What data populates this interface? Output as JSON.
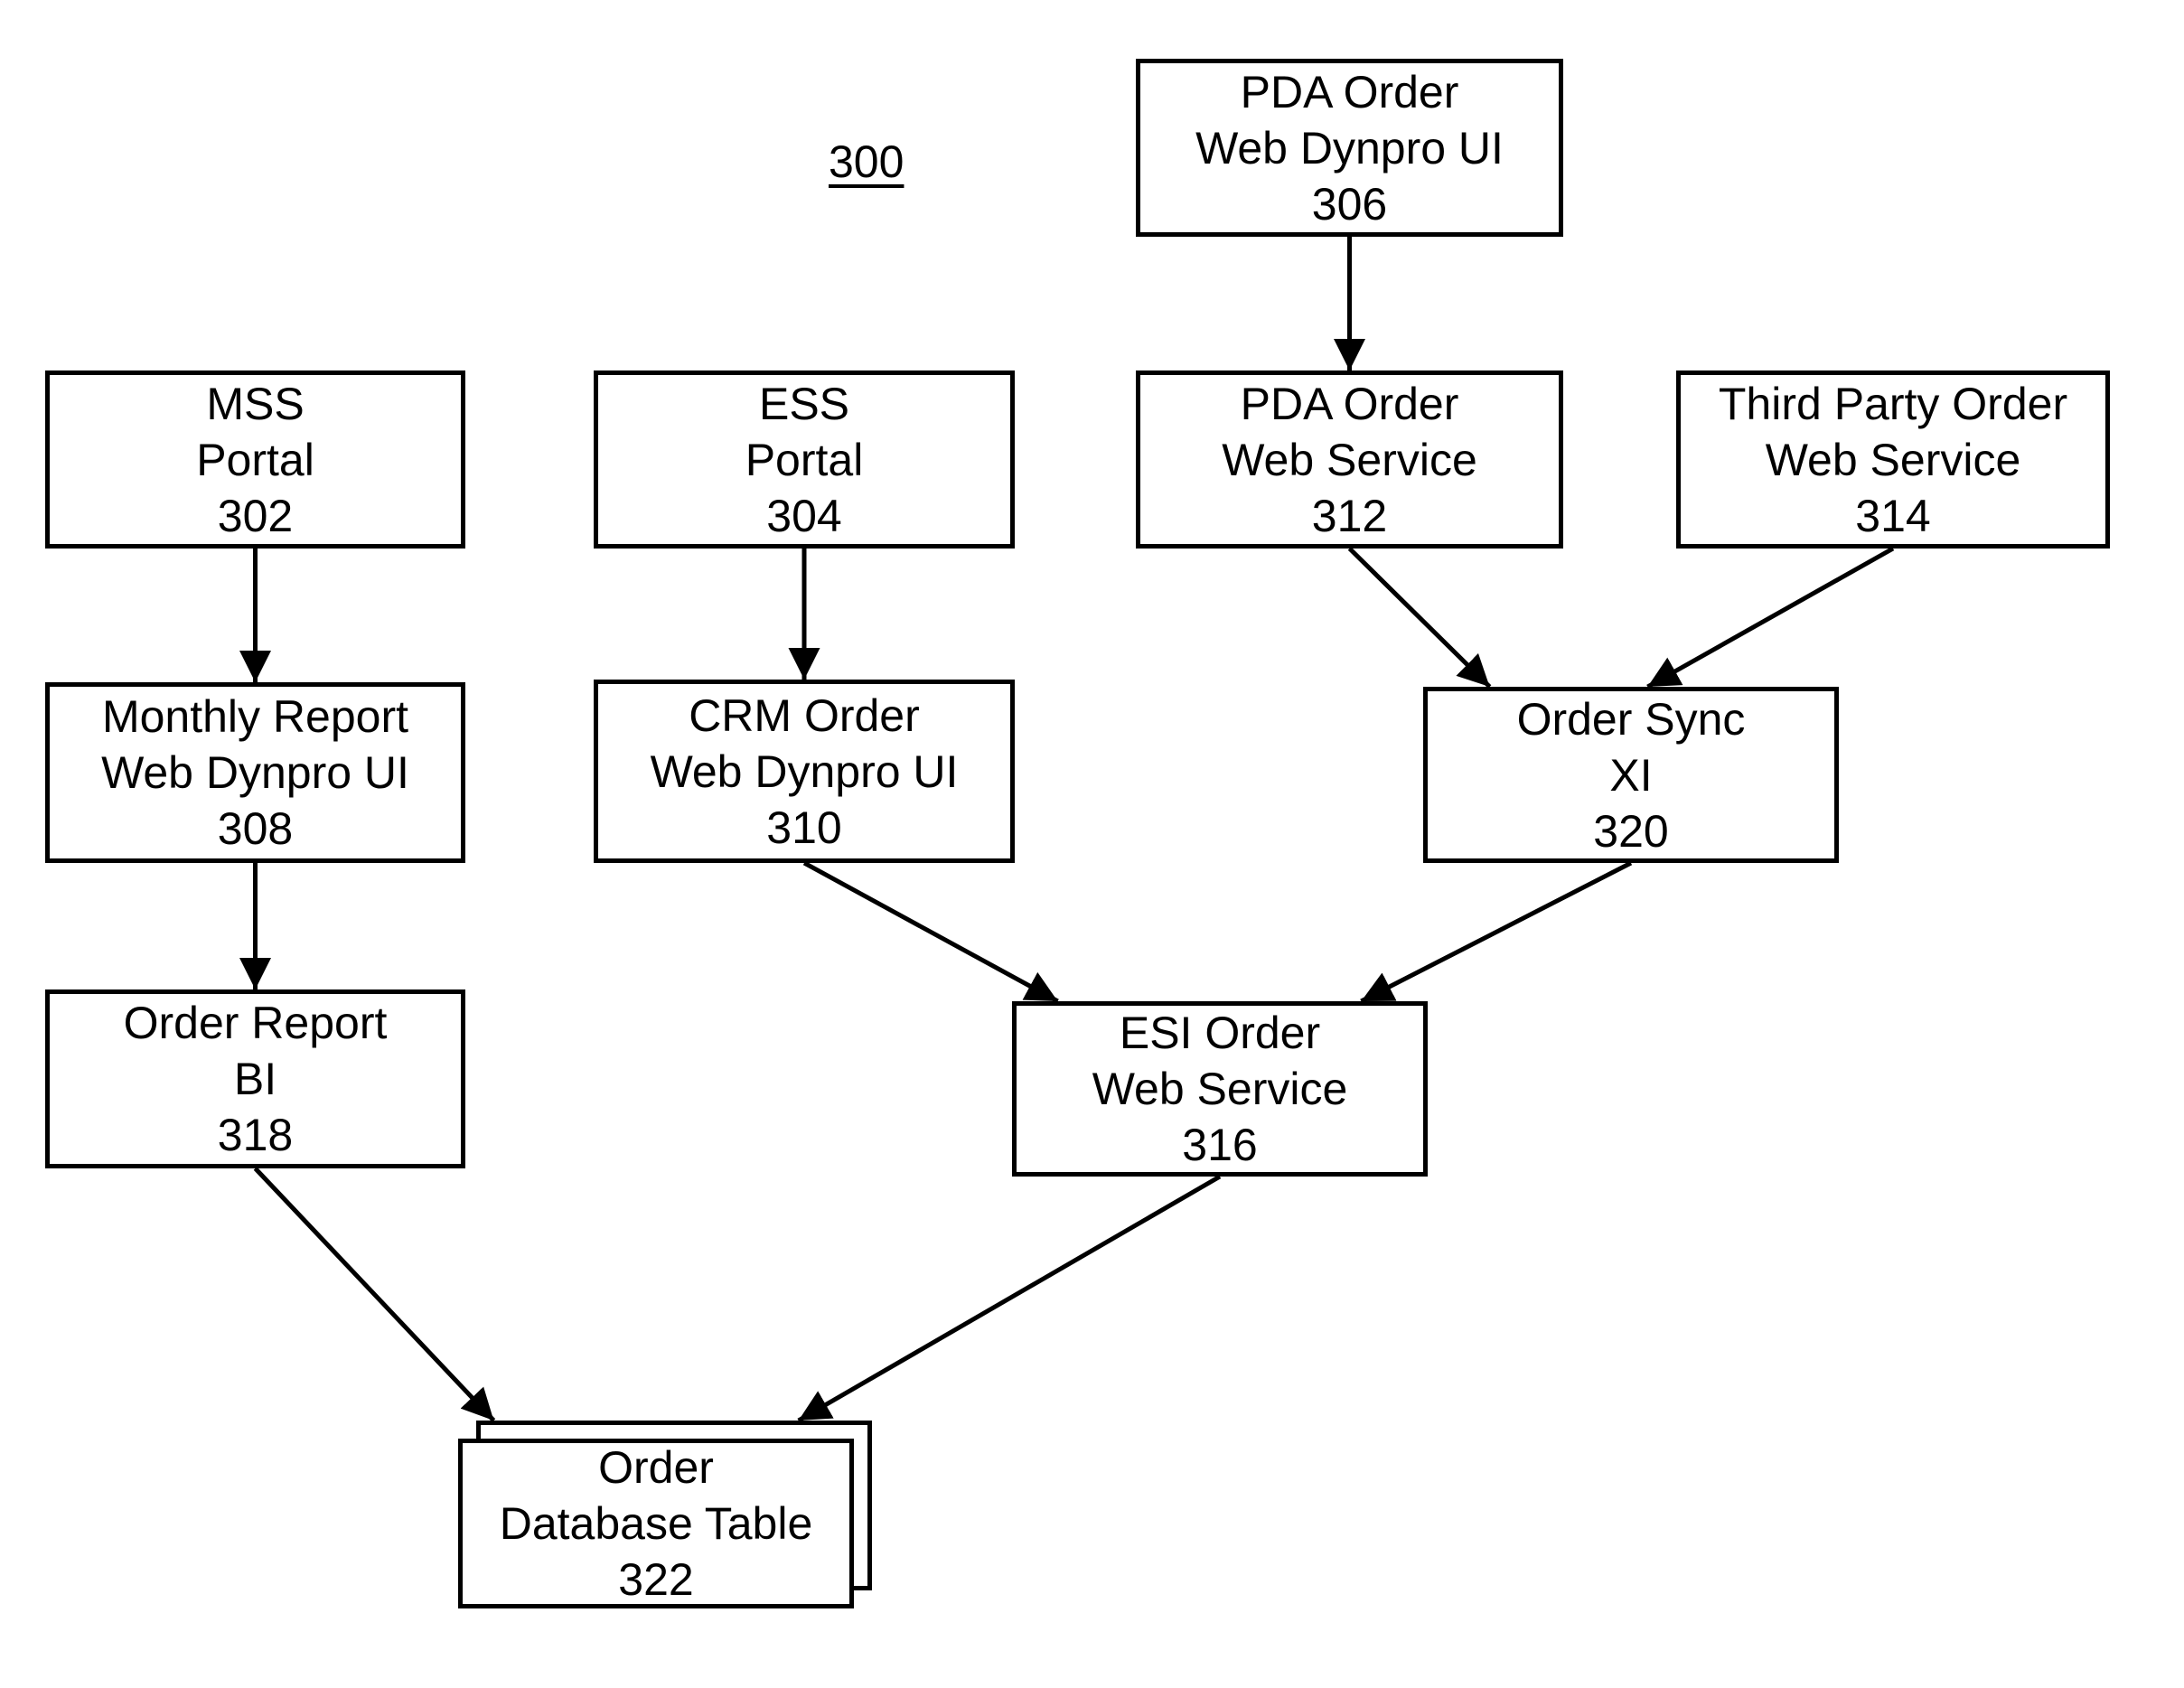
{
  "figure": {
    "label": "300"
  },
  "nodes": [
    {
      "id": "306",
      "lines": [
        "PDA Order",
        "Web Dynpro UI",
        "306"
      ]
    },
    {
      "id": "302",
      "lines": [
        "MSS",
        "Portal",
        "302"
      ]
    },
    {
      "id": "304",
      "lines": [
        "ESS",
        "Portal",
        "304"
      ]
    },
    {
      "id": "312",
      "lines": [
        "PDA Order",
        "Web Service",
        "312"
      ]
    },
    {
      "id": "314",
      "lines": [
        "Third Party Order",
        "Web Service",
        "314"
      ]
    },
    {
      "id": "308",
      "lines": [
        "Monthly Report",
        "Web Dynpro UI",
        "308"
      ]
    },
    {
      "id": "310",
      "lines": [
        "CRM Order",
        "Web Dynpro UI",
        "310"
      ]
    },
    {
      "id": "320",
      "lines": [
        "Order Sync",
        "XI",
        "320"
      ]
    },
    {
      "id": "318",
      "lines": [
        "Order Report",
        "BI",
        "318"
      ]
    },
    {
      "id": "316",
      "lines": [
        "ESI Order",
        "Web Service",
        "316"
      ]
    },
    {
      "id": "322",
      "lines": [
        "Order",
        "Database Table",
        "322"
      ]
    }
  ],
  "edges": [
    {
      "from": "306",
      "to": "312"
    },
    {
      "from": "302",
      "to": "308"
    },
    {
      "from": "308",
      "to": "318"
    },
    {
      "from": "304",
      "to": "310"
    },
    {
      "from": "312",
      "to": "320"
    },
    {
      "from": "314",
      "to": "320"
    },
    {
      "from": "310",
      "to": "316"
    },
    {
      "from": "320",
      "to": "316"
    },
    {
      "from": "318",
      "to": "322"
    },
    {
      "from": "316",
      "to": "322"
    }
  ]
}
